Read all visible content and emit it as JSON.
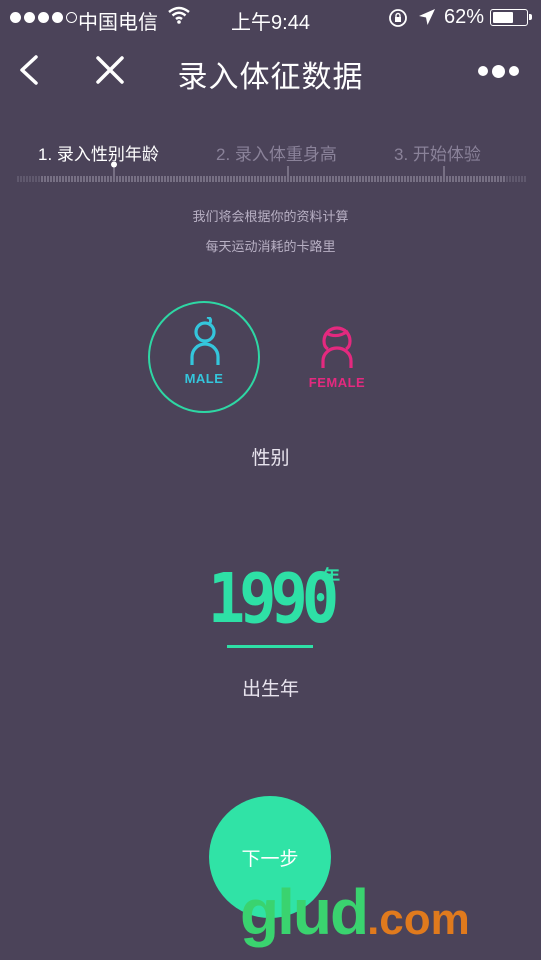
{
  "status_bar": {
    "carrier": "中国电信",
    "time": "上午9:44",
    "battery": "62%",
    "battery_level": 0.62
  },
  "nav": {
    "title": "录入体征数据",
    "back_icon": "chevron-left-icon",
    "close_icon": "close-icon",
    "more_icon": "more-dots-icon"
  },
  "steps": [
    {
      "label": "1. 录入性别年龄",
      "active": true
    },
    {
      "label": "2. 录入体重身高",
      "active": false
    },
    {
      "label": "3. 开始体验",
      "active": false
    }
  ],
  "hint": {
    "line1": "我们将会根据你的资料计算",
    "line2": "每天运动消耗的卡路里"
  },
  "gender": {
    "male_label": "MALE",
    "female_label": "FEMALE",
    "selected": "male",
    "caption": "性别"
  },
  "birth_year": {
    "value": "1990",
    "unit": "年",
    "caption": "出生年"
  },
  "next_button": "下一步",
  "watermark": {
    "main": "glud",
    "suffix": ".com"
  },
  "colors": {
    "background": "#4b4359",
    "accent": "#2ee0a6",
    "male": "#34c6dc",
    "female": "#e4297f"
  }
}
